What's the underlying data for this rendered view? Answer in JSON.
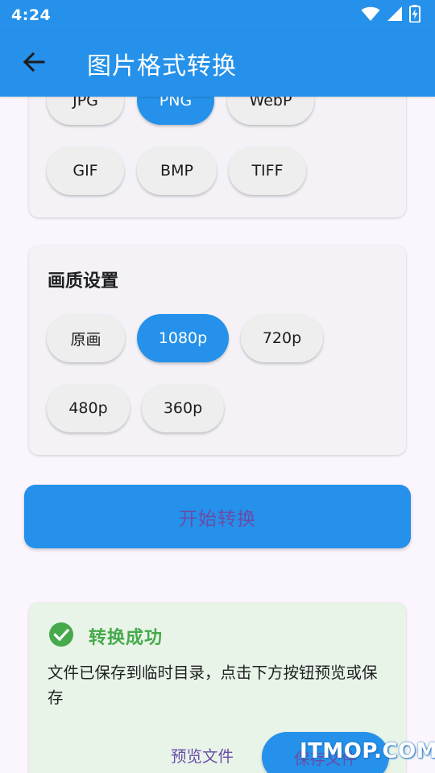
{
  "status_bar": {
    "time": "4:24"
  },
  "app_bar": {
    "title": "图片格式转换"
  },
  "format_card": {
    "chips": [
      {
        "label": "JPG",
        "selected": false
      },
      {
        "label": "PNG",
        "selected": true
      },
      {
        "label": "WebP",
        "selected": false
      },
      {
        "label": "GIF",
        "selected": false
      },
      {
        "label": "BMP",
        "selected": false
      },
      {
        "label": "TIFF",
        "selected": false
      }
    ]
  },
  "quality_card": {
    "title": "画质设置",
    "chips": [
      {
        "label": "原画",
        "selected": false
      },
      {
        "label": "1080p",
        "selected": true
      },
      {
        "label": "720p",
        "selected": false
      },
      {
        "label": "480p",
        "selected": false
      },
      {
        "label": "360p",
        "selected": false
      }
    ]
  },
  "start_button": {
    "label": "开始转换"
  },
  "success_card": {
    "title": "转换成功",
    "message": "文件已保存到临时目录，点击下方按钮预览或保存",
    "preview_label": "预览文件",
    "save_label": "保存文件"
  },
  "watermark": {
    "text": "ITMOP.COM"
  },
  "colors": {
    "primary": "#2591ea",
    "button_text": "#6a4ca8",
    "success": "#46a94b",
    "card_background": "#f4f2f6",
    "success_background": "#e8f4e8",
    "page_background": "#fbf6fd"
  },
  "icons": {
    "back": "arrow-back-icon",
    "wifi": "wifi-icon",
    "signal": "cell-signal-icon",
    "battery": "battery-charging-icon",
    "success": "check-circle-icon"
  }
}
